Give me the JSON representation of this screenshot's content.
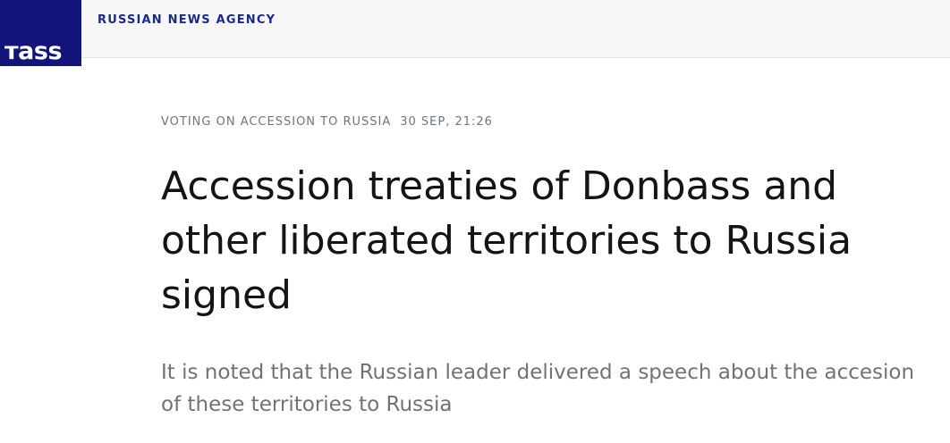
{
  "header": {
    "logo_text": "тass",
    "agency_name": "RUSSIAN NEWS AGENCY"
  },
  "article": {
    "category": "VOTING ON ACCESSION TO RUSSIA",
    "timestamp": "30 SEP, 21:26",
    "headline": "Accession treaties of Donbass and other liberated territories to Russia signed",
    "lead": "It is noted that the Russian leader delivered a speech about the accesion of these territories to Russia"
  },
  "colors": {
    "brand": "#12147a",
    "agency_text": "#1a2a8c",
    "headline": "#141414",
    "lead": "#6f7378",
    "meta": "#6d7580"
  }
}
